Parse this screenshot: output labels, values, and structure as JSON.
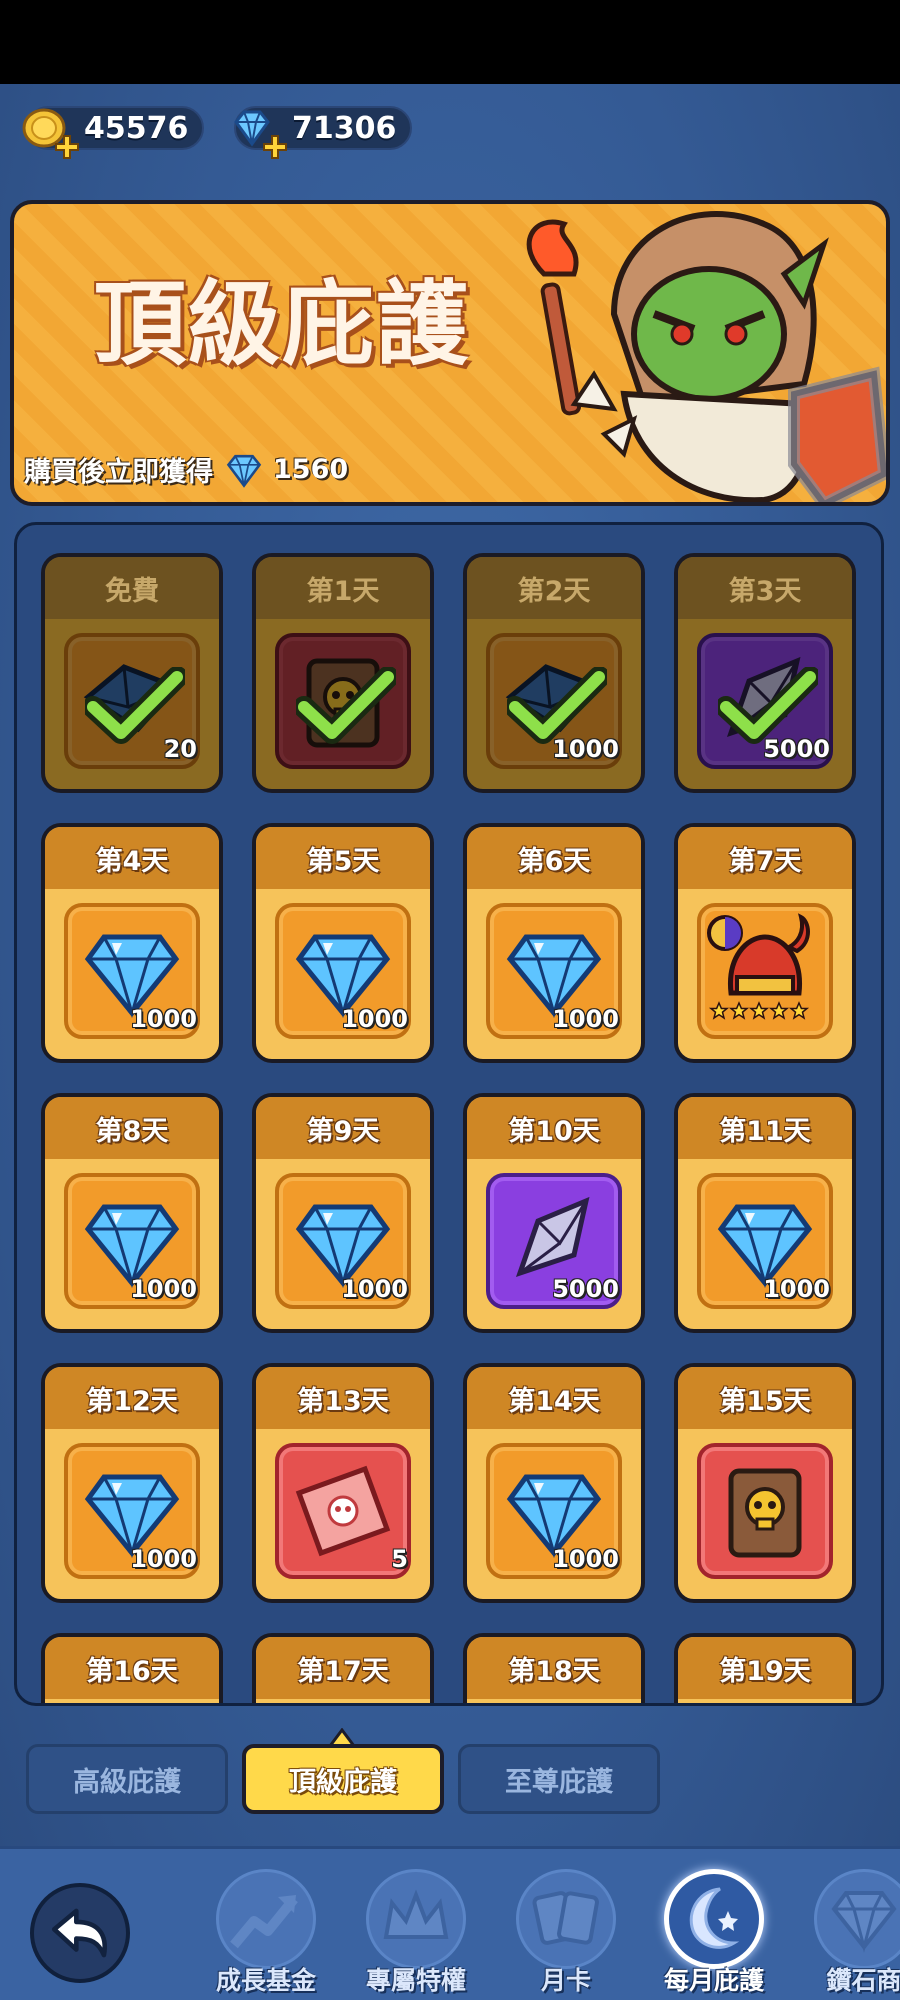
{
  "currency": {
    "coins": "45576",
    "gems": "71306"
  },
  "banner": {
    "title": "頂級庇護",
    "subtitle": "購買後立即獲得",
    "instant_gems": "1560"
  },
  "rewards": [
    {
      "label": "免費",
      "item": "crystal",
      "qty": "20",
      "claimed": true
    },
    {
      "label": "第1天",
      "item": "skull-card",
      "qty": "",
      "claimed": true
    },
    {
      "label": "第2天",
      "item": "crystal",
      "qty": "1000",
      "claimed": true
    },
    {
      "label": "第3天",
      "item": "purple-stone",
      "qty": "5000",
      "claimed": true
    },
    {
      "label": "第4天",
      "item": "gem",
      "qty": "1000",
      "claimed": false
    },
    {
      "label": "第5天",
      "item": "gem",
      "qty": "1000",
      "claimed": false
    },
    {
      "label": "第6天",
      "item": "gem",
      "qty": "1000",
      "claimed": false
    },
    {
      "label": "第7天",
      "item": "helmet",
      "qty": "",
      "claimed": false
    },
    {
      "label": "第8天",
      "item": "gem",
      "qty": "1000",
      "claimed": false
    },
    {
      "label": "第9天",
      "item": "gem",
      "qty": "1000",
      "claimed": false
    },
    {
      "label": "第10天",
      "item": "purple-stone",
      "qty": "5000",
      "claimed": false
    },
    {
      "label": "第11天",
      "item": "gem",
      "qty": "1000",
      "claimed": false
    },
    {
      "label": "第12天",
      "item": "gem",
      "qty": "1000",
      "claimed": false
    },
    {
      "label": "第13天",
      "item": "skull-ticket",
      "qty": "5",
      "claimed": false
    },
    {
      "label": "第14天",
      "item": "gem",
      "qty": "1000",
      "claimed": false
    },
    {
      "label": "第15天",
      "item": "skull-card",
      "qty": "",
      "claimed": false
    },
    {
      "label": "第16天",
      "item": "",
      "qty": "",
      "claimed": false
    },
    {
      "label": "第17天",
      "item": "",
      "qty": "",
      "claimed": false
    },
    {
      "label": "第18天",
      "item": "",
      "qty": "",
      "claimed": false
    },
    {
      "label": "第19天",
      "item": "",
      "qty": "",
      "claimed": false
    }
  ],
  "tabs": [
    {
      "label": "高級庇護",
      "active": false
    },
    {
      "label": "頂級庇護",
      "active": true
    },
    {
      "label": "至尊庇護",
      "active": false
    }
  ],
  "nav": [
    {
      "label": "成長基金",
      "icon": "growth-chart-icon",
      "active": false
    },
    {
      "label": "專屬特權",
      "icon": "crown-icon",
      "active": false
    },
    {
      "label": "月卡",
      "icon": "cards-icon",
      "active": false
    },
    {
      "label": "每月庇護",
      "icon": "moon-star-icon",
      "active": true
    },
    {
      "label": "鑽石商",
      "icon": "diamond-icon",
      "active": false
    }
  ]
}
